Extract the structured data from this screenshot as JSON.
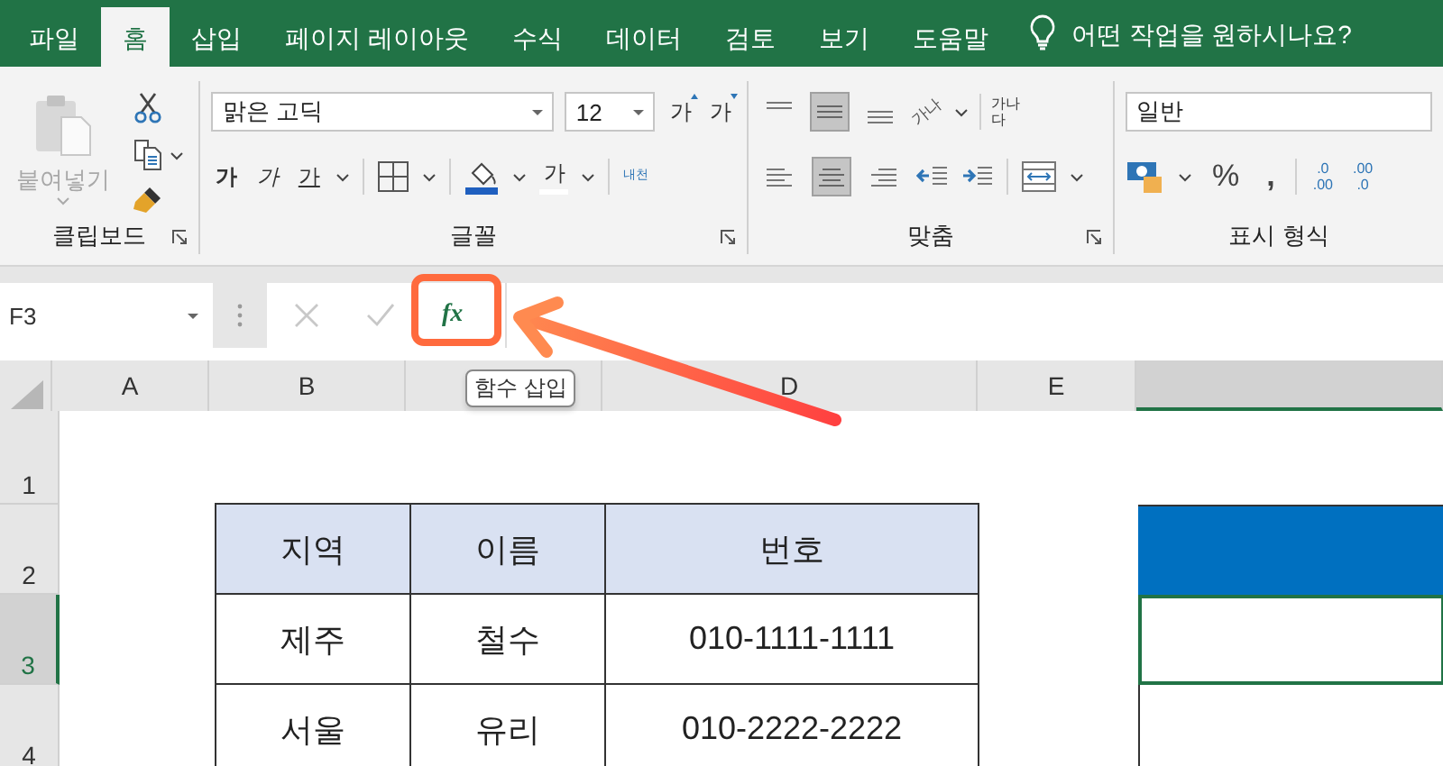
{
  "tabs": [
    {
      "label": "파일",
      "selected": false
    },
    {
      "label": "홈",
      "selected": true
    },
    {
      "label": "삽입",
      "selected": false
    },
    {
      "label": "페이지 레이아웃",
      "selected": false
    },
    {
      "label": "수식",
      "selected": false
    },
    {
      "label": "데이터",
      "selected": false
    },
    {
      "label": "검토",
      "selected": false
    },
    {
      "label": "보기",
      "selected": false
    },
    {
      "label": "도움말",
      "selected": false
    }
  ],
  "tell_me": "어떤 작업을 원하시나요?",
  "ribbon": {
    "clipboard": {
      "title": "클립보드",
      "paste_label": "붙여넣기",
      "paste_disabled": true
    },
    "font": {
      "title": "글꼴",
      "font_name": "맑은 고딕",
      "font_size": "12",
      "grow_label": "가",
      "shrink_label": "가",
      "bold_label": "가",
      "italic_label": "가",
      "underline_label": "가",
      "font_color_label": "가",
      "phonetic_label": "내천"
    },
    "alignment": {
      "title": "맞춤",
      "orientation_label": "가나",
      "wrap_label": "가나다",
      "top_align_selected": false,
      "middle_align_selected": true,
      "bottom_align_selected": false,
      "left_align_selected": false,
      "center_align_selected": true,
      "right_align_selected": false
    },
    "number": {
      "title": "표시 형식",
      "format": "일반",
      "percent_label": "%",
      "comma_label": ",",
      "decimal_buttons": [
        {
          "top": ".0",
          "bottom": ".00"
        },
        {
          "top": ".00",
          "bottom": ".0"
        }
      ]
    }
  },
  "formula_bar": {
    "name_box": "F3",
    "fx_label": "fx",
    "tooltip": "함수 삽입"
  },
  "sheet": {
    "columns": [
      {
        "label": "A",
        "selected": false
      },
      {
        "label": "B",
        "selected": false
      },
      {
        "selected": false
      },
      {
        "label": "D",
        "selected": false
      },
      {
        "label": "E",
        "selected": false
      },
      {
        "selected": true
      }
    ],
    "rows": [
      {
        "label": "1",
        "selected": false
      },
      {
        "label": "2",
        "selected": false
      },
      {
        "label": "3",
        "selected": true
      },
      {
        "label": "4",
        "selected": false
      }
    ],
    "table": {
      "headers": [
        "지역",
        "이름",
        "번호"
      ],
      "rows": [
        [
          "제주",
          "철수",
          "010-1111-1111"
        ],
        [
          "서울",
          "유리",
          "010-2222-2222"
        ]
      ]
    }
  }
}
